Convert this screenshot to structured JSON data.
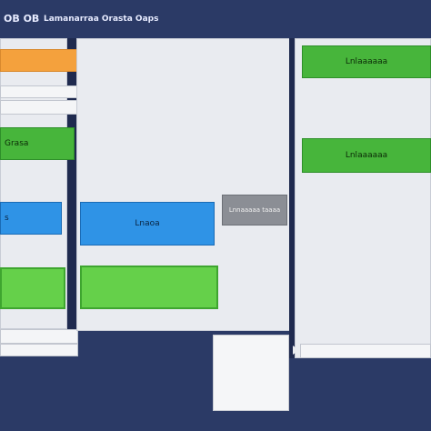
{
  "header": {
    "title_short": "OB OB",
    "title_long": "Lamanarraa Orasta Oaps"
  },
  "left_column": {
    "green_header_label": "Grasa",
    "blue_item_label": "s"
  },
  "center_column": {
    "blue_button_label": "Lnaoa",
    "gray_button_label": "Lnnaaaaa taaaa"
  },
  "right_column": {
    "green_button_top_label": "Lnlaaaaaa",
    "green_button_mid_label": "Lnlaaaaaa"
  },
  "colors": {
    "background": "#2b3a66",
    "panel": "#e9ebf0",
    "green": "#47b53b",
    "blue": "#2f93e6",
    "orange": "#f4a13d"
  }
}
